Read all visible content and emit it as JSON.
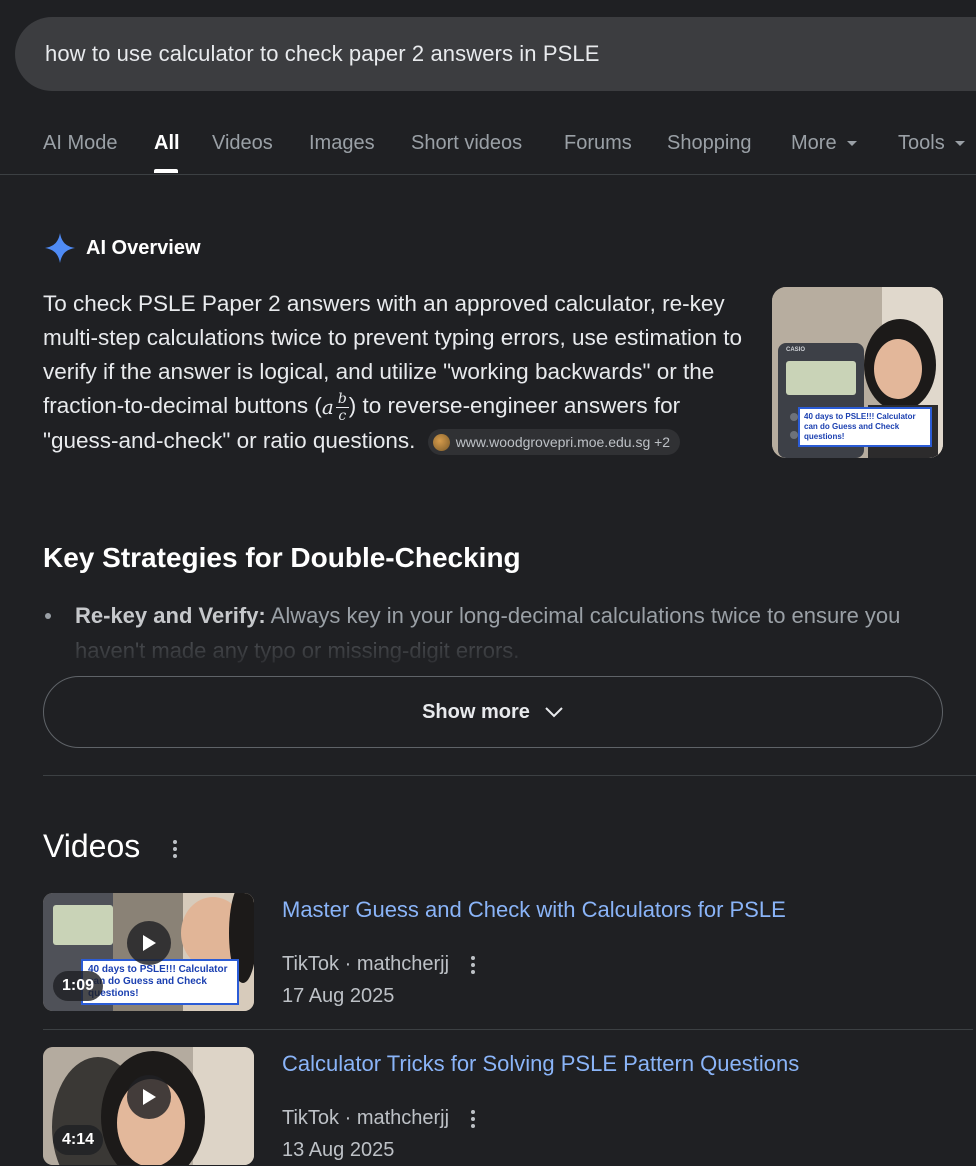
{
  "search": {
    "query": "how to use calculator to check paper 2 answers in PSLE"
  },
  "tabs": [
    {
      "label": "AI Mode"
    },
    {
      "label": "All"
    },
    {
      "label": "Videos"
    },
    {
      "label": "Images"
    },
    {
      "label": "Short videos"
    },
    {
      "label": "Forums"
    },
    {
      "label": "Shopping"
    },
    {
      "label": "More"
    },
    {
      "label": "Tools"
    }
  ],
  "ai_overview": {
    "title": "AI Overview",
    "text_part1": "To check PSLE Paper 2 answers with an approved calculator, re-key multi-step calculations twice to prevent typing errors, use estimation to verify if the answer is logical, and utilize \"working backwards\" or the fraction-to-decimal buttons (",
    "frac_a": "a",
    "frac_b": "b",
    "frac_c": "c",
    "text_part2": ") to reverse-engineer answers for \"guess-and-check\" or ratio questions.",
    "source": "www.woodgrovepri.moe.edu.sg +2",
    "thumb_caption": "40 days to PSLE!!! Calculator can do Guess and Check questions!",
    "thumb_brand": "CASIO",
    "heading": "Key Strategies for Double-Checking",
    "bullet_bold": "Re-key and Verify:",
    "bullet_text": " Always key in your long-decimal calculations twice to ensure you haven't made any typo or missing-digit errors.",
    "show_more": "Show more"
  },
  "videos": {
    "section_title": "Videos",
    "items": [
      {
        "title": "Master Guess and Check with Calculators for PSLE",
        "source": "TikTok · mathcherjj",
        "date": "17 Aug 2025",
        "duration": "1:09",
        "caption": "40 days to PSLE!!! Calculator can do Guess and Check questions!"
      },
      {
        "title": "Calculator Tricks for Solving PSLE Pattern Questions",
        "source": "TikTok · mathcherjj",
        "date": "13 Aug 2025",
        "duration": "4:14"
      }
    ]
  },
  "colors": {
    "background": "#1f2023",
    "link": "#8ab4f8",
    "ai_star": "#4f8bf5"
  }
}
